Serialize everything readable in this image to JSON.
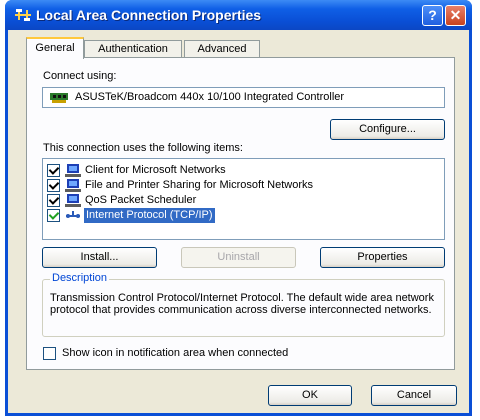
{
  "window": {
    "title": "Local Area Connection Properties",
    "help_label": "?",
    "close_label": "✕"
  },
  "tabs": [
    {
      "label": "General",
      "active": true
    },
    {
      "label": "Authentication",
      "active": false
    },
    {
      "label": "Advanced",
      "active": false
    }
  ],
  "general": {
    "connect_using_label": "Connect using:",
    "adapter_name": "ASUSTeK/Broadcom 440x 10/100 Integrated Controller",
    "configure_label": "Configure...",
    "items_label": "This connection uses the following items:",
    "items": [
      {
        "label": "Client for Microsoft Networks",
        "checked": true,
        "icon": "network-client-icon",
        "selected": false
      },
      {
        "label": "File and Printer Sharing for Microsoft Networks",
        "checked": true,
        "icon": "file-printer-sharing-icon",
        "selected": false
      },
      {
        "label": "QoS Packet Scheduler",
        "checked": true,
        "icon": "qos-scheduler-icon",
        "selected": false
      },
      {
        "label": "Internet Protocol (TCP/IP)",
        "checked": true,
        "icon": "protocol-icon",
        "selected": true
      }
    ],
    "install_label": "Install...",
    "uninstall_label": "Uninstall",
    "properties_label": "Properties",
    "description_legend": "Description",
    "description_text": "Transmission Control Protocol/Internet Protocol. The default wide area network protocol that provides communication across diverse interconnected networks.",
    "show_icon_label": "Show icon in notification area when connected",
    "show_icon_checked": false
  },
  "footer": {
    "ok_label": "OK",
    "cancel_label": "Cancel"
  },
  "colors": {
    "titlebar": "#0a4fd6",
    "dialog_bg": "#ece9d8",
    "selection": "#316ac5",
    "legend_text": "#0046d5"
  }
}
